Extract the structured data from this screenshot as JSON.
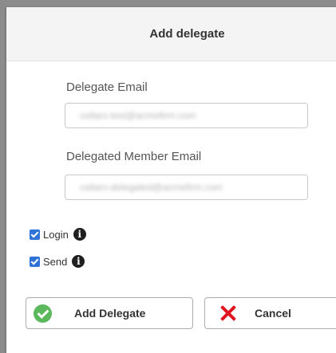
{
  "dialog": {
    "title": "Add delegate"
  },
  "form": {
    "delegate_email_label": "Delegate Email",
    "delegate_email_value": "cellars-test@acmefirm.com",
    "member_email_label": "Delegated Member Email",
    "member_email_value": "cellars-delegated@acmefirm.com"
  },
  "permissions": [
    {
      "label": "Login",
      "checked": true,
      "icon": "info-icon"
    },
    {
      "label": "Send",
      "checked": true,
      "icon": "info-icon"
    }
  ],
  "actions": {
    "add_label": "Add Delegate",
    "add_icon": "check-circle-icon",
    "cancel_label": "Cancel",
    "cancel_icon": "close-icon"
  },
  "colors": {
    "checkbox": "#2f73d9",
    "add_icon": "#5cb85c",
    "cancel_icon": "#e0141e"
  }
}
